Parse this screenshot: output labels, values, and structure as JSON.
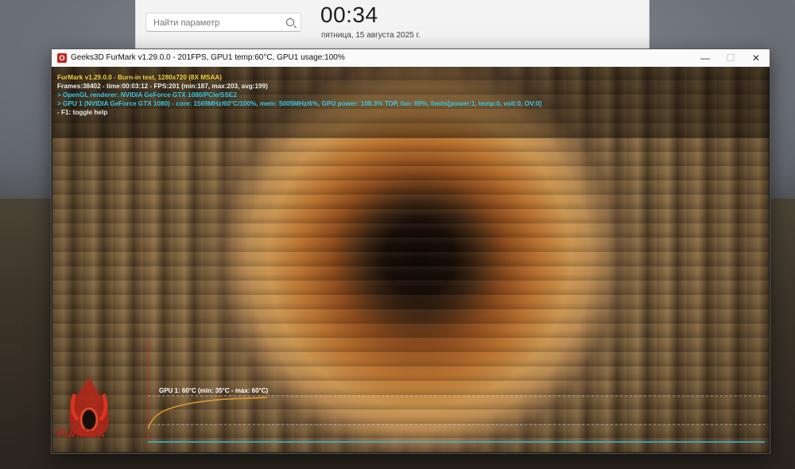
{
  "settings": {
    "search_placeholder": "Найти параметр",
    "clock": "00:34",
    "date": "пятница, 15 августа 2025 г."
  },
  "window": {
    "title": "Geeks3D FurMark v1.29.0.0 - 201FPS, GPU1 temp:60°C, GPU1 usage:100%",
    "icon_letter": "O",
    "minimize": "—",
    "maximize": "☐",
    "close": "✕"
  },
  "overlay": {
    "line1": "FurMark v1.29.0.0 - Burn-in test, 1280x720 (8X MSAA)",
    "line2": "Frames:38402 - time:00:03:12 - FPS:201 (min:187, max:203, avg:199)",
    "line3": "> OpenGL renderer: NVIDIA GeForce GTX 1080/PCIe/SSE2",
    "line4": "> GPU 1 (NVIDIA GeForce GTX 1080) - core: 1569MHz/60°C/100%, mem: 5005MHz/6%, GPU power: 108.3% TDP, fan: 69%, limits[power:1, temp:0, volt:0, OV:0]",
    "line5": "- F1: toggle help"
  },
  "graph": {
    "label": "GPU 1: 60°C (min: 35°C - max: 60°C)",
    "temp_min": 35,
    "temp_max": 60,
    "temp_current": 60
  },
  "logo": {
    "text": "FurMark"
  },
  "colors": {
    "overlay_title": "#f3d23a",
    "overlay_info": "#36c7e6",
    "graph_line": "#e89a2a",
    "graph_base": "#36b8e0",
    "logo": "#b3261a"
  }
}
